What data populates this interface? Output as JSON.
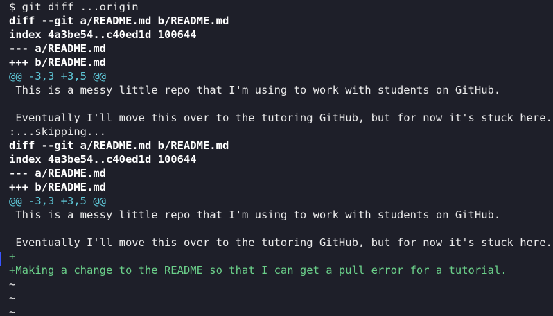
{
  "terminal": {
    "lines": [
      {
        "text": "$ git diff ...origin",
        "style": "plain",
        "name": "command-line"
      },
      {
        "text": "diff --git a/README.md b/README.md",
        "style": "bold",
        "name": "diff-header"
      },
      {
        "text": "index 4a3be54..c40ed1d 100644",
        "style": "bold",
        "name": "diff-index"
      },
      {
        "text": "--- a/README.md",
        "style": "bold",
        "name": "diff-old-file"
      },
      {
        "text": "+++ b/README.md",
        "style": "bold",
        "name": "diff-new-file"
      },
      {
        "text": "@@ -3,3 +3,5 @@",
        "style": "hunk",
        "name": "hunk-header"
      },
      {
        "text": " This is a messy little repo that I'm using to work with students on GitHub.",
        "style": "plain",
        "name": "context-line"
      },
      {
        "text": "",
        "style": "plain",
        "name": "blank-line"
      },
      {
        "text": " Eventually I'll move this over to the tutoring GitHub, but for now it's stuck here.",
        "style": "plain",
        "name": "context-line"
      },
      {
        "text": ":...skipping...",
        "style": "plain",
        "name": "pager-skipping"
      },
      {
        "text": "diff --git a/README.md b/README.md",
        "style": "bold",
        "name": "diff-header"
      },
      {
        "text": "index 4a3be54..c40ed1d 100644",
        "style": "bold",
        "name": "diff-index"
      },
      {
        "text": "--- a/README.md",
        "style": "bold",
        "name": "diff-old-file"
      },
      {
        "text": "+++ b/README.md",
        "style": "bold",
        "name": "diff-new-file"
      },
      {
        "text": "@@ -3,3 +3,5 @@",
        "style": "hunk",
        "name": "hunk-header"
      },
      {
        "text": " This is a messy little repo that I'm using to work with students on GitHub.",
        "style": "plain",
        "name": "context-line"
      },
      {
        "text": "",
        "style": "plain",
        "name": "blank-line"
      },
      {
        "text": " Eventually I'll move this over to the tutoring GitHub, but for now it's stuck here.",
        "style": "plain",
        "name": "context-line"
      },
      {
        "text": "+",
        "style": "added",
        "name": "added-line"
      },
      {
        "text": "+Making a change to the README so that I can get a pull error for a tutorial.",
        "style": "added",
        "name": "added-line"
      },
      {
        "text": "~",
        "style": "tilde",
        "name": "pager-tilde"
      },
      {
        "text": "~",
        "style": "tilde",
        "name": "pager-tilde"
      },
      {
        "text": "~",
        "style": "tilde",
        "name": "pager-tilde"
      }
    ]
  },
  "colors": {
    "background": "#1e1f29",
    "foreground": "#ebebeb",
    "hunk": "#5fc9d9",
    "added": "#6bd08a",
    "cursor": "#3a54ff"
  }
}
